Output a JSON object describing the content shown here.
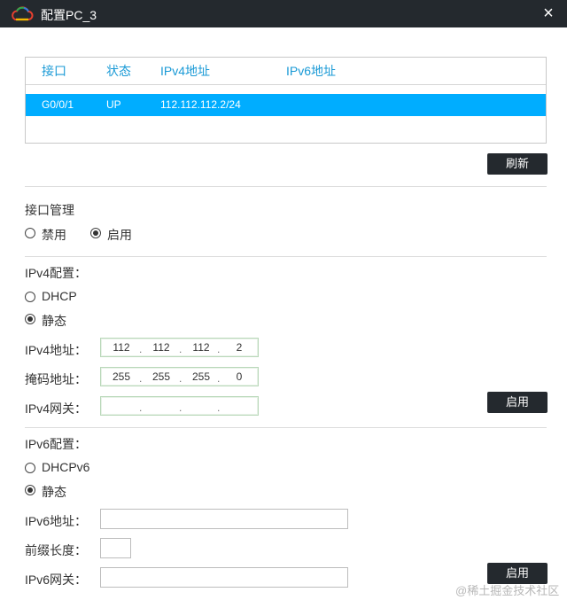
{
  "window": {
    "title": "配置PC_3",
    "app_icon": "cloud-icon",
    "close_icon": "×"
  },
  "interfaces": {
    "columns": [
      "接口",
      "状态",
      "IPv4地址",
      "IPv6地址"
    ],
    "rows": [
      {
        "name": "G0/0/1",
        "status": "UP",
        "ipv4": "112.112.112.2/24",
        "ipv6": ""
      }
    ],
    "selected_row_color": "#00adff"
  },
  "refresh_button": "刷新",
  "interface_mgmt": {
    "title": "接口管理",
    "disable_label": "禁用",
    "enable_label": "启用",
    "selected": "启用"
  },
  "ipv4": {
    "section_title": "IPv4配置：",
    "dhcp_label": "DHCP",
    "static_label": "静态",
    "selected": "静态",
    "address_label": "IPv4地址：",
    "address": [
      "112",
      "112",
      "112",
      "2"
    ],
    "mask_label": "掩码地址：",
    "mask": [
      "255",
      "255",
      "255",
      "0"
    ],
    "gateway_label": "IPv4网关：",
    "gateway": [
      "",
      "",
      "",
      ""
    ],
    "apply_button": "启用"
  },
  "ipv6": {
    "section_title": "IPv6配置：",
    "dhcp_label": "DHCPv6",
    "static_label": "静态",
    "selected": "静态",
    "address_label": "IPv6地址：",
    "address": "",
    "prefix_label": "前缀长度：",
    "prefix": "",
    "gateway_label": "IPv6网关：",
    "gateway": "",
    "apply_button": "启用"
  },
  "watermark": "@稀土掘金技术社区",
  "colors": {
    "titlebar": "#24292e",
    "header_text": "#1a9ad6",
    "button": "#24292e"
  }
}
